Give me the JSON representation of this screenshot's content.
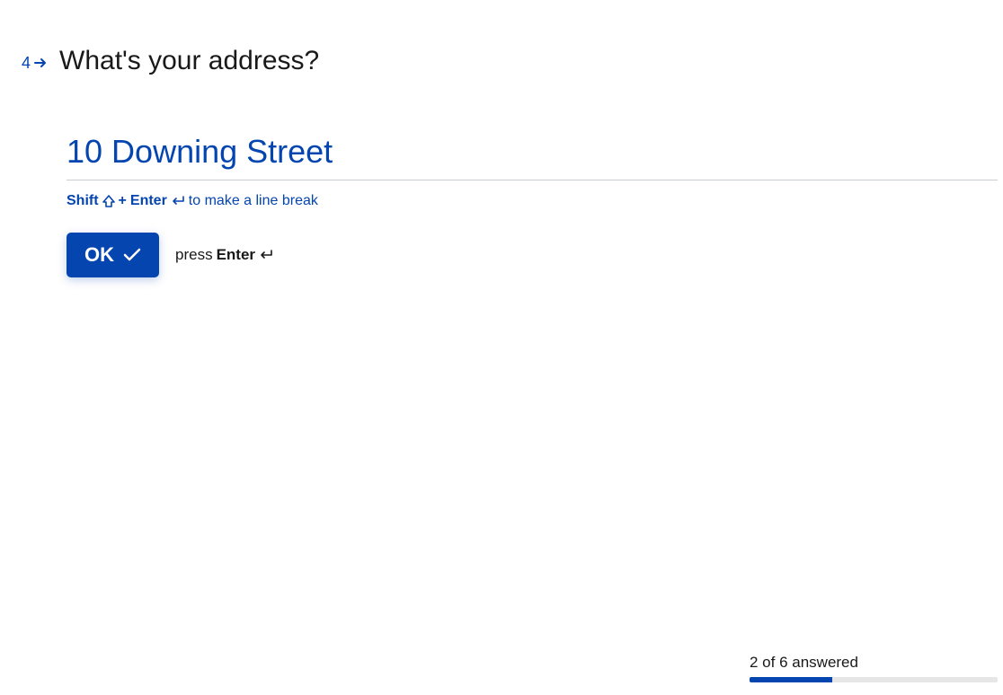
{
  "question": {
    "number": "4",
    "title": "What's your address?",
    "answer_value": "10 Downing Street"
  },
  "hint": {
    "shift": "Shift",
    "plus": "+",
    "enter": "Enter",
    "rest": "to make a line break"
  },
  "ok": {
    "label": "OK",
    "press": "press",
    "enter": "Enter"
  },
  "progress": {
    "text": "2 of 6 answered",
    "current": 2,
    "total": 6
  },
  "colors": {
    "accent": "#0445AF"
  }
}
